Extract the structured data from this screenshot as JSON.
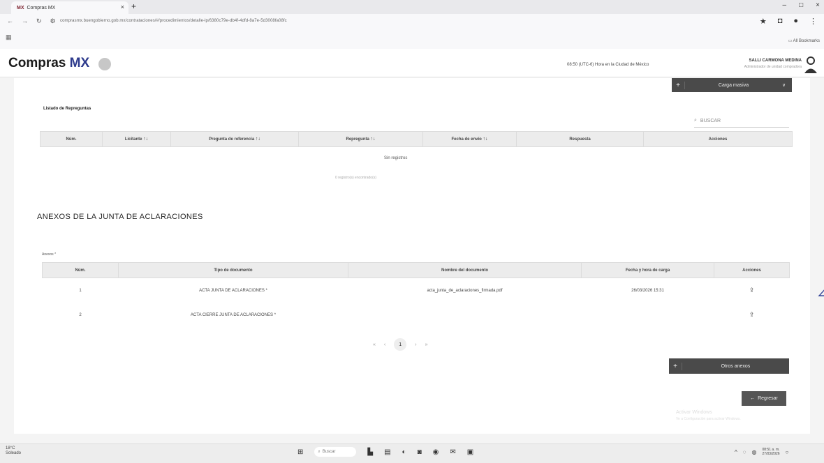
{
  "browser": {
    "tab_title": "Compras MX",
    "url": "comprasmx.buengobierno.gob.mx/contrataciones/#/procedimientos/detalle-lp/6380c79e-db4f-4dfd-8a7e-5d3008fa08fc",
    "favorites_label": "All Bookmarks"
  },
  "header": {
    "brand": "Compras",
    "brand_mark": "MX",
    "clock_text": "08:50 (UTC-6) Hora en la Ciudad de México",
    "user_name": "SALLI CARMONA MEDINA",
    "user_role": "Administrador de unidad compradora"
  },
  "toolbar": {
    "carga_masiva": "Carga masiva"
  },
  "repreguntas": {
    "title": "Listado de Repreguntas",
    "search_placeholder": "BUSCAR",
    "columns": [
      "Núm.",
      "Licitante",
      "Pregunta de referencia",
      "Repregunta",
      "Fecha de envío",
      "Respuesta",
      "Acciones"
    ],
    "empty_text": "Sin registros",
    "pagination_text": "0 registro(s) encontrado(s)"
  },
  "anexos": {
    "section_title": "ANEXOS DE LA JUNTA DE ACLARACIONES",
    "field_label": "Anexos *",
    "columns": [
      "Núm.",
      "Tipo de documento",
      "Nombre del documento",
      "Fecha y hora de carga",
      "Acciones"
    ],
    "rows": [
      {
        "num": "1",
        "tipo": "ACTA JUNTA DE ACLARACIONES *",
        "nombre": "acta_junta_de_aclaraciones_firmada.pdf",
        "fecha": "26/03/2026 15:31"
      },
      {
        "num": "2",
        "tipo": "ACTA CIERRE JUNTA DE ACLARACIONES *",
        "nombre": "",
        "fecha": ""
      }
    ],
    "current_page": "1",
    "otros_anexos": "Otros anexos"
  },
  "footer": {
    "regresar": "Regresar",
    "watermark_title": "Activar Windows",
    "watermark_sub": "Ve a Configuración para activar Windows."
  },
  "taskbar": {
    "temperature": "18°C",
    "weather": "Soleado",
    "search_label": "Buscar",
    "time": "08:51 a. m.",
    "date": "27/03/2026"
  }
}
